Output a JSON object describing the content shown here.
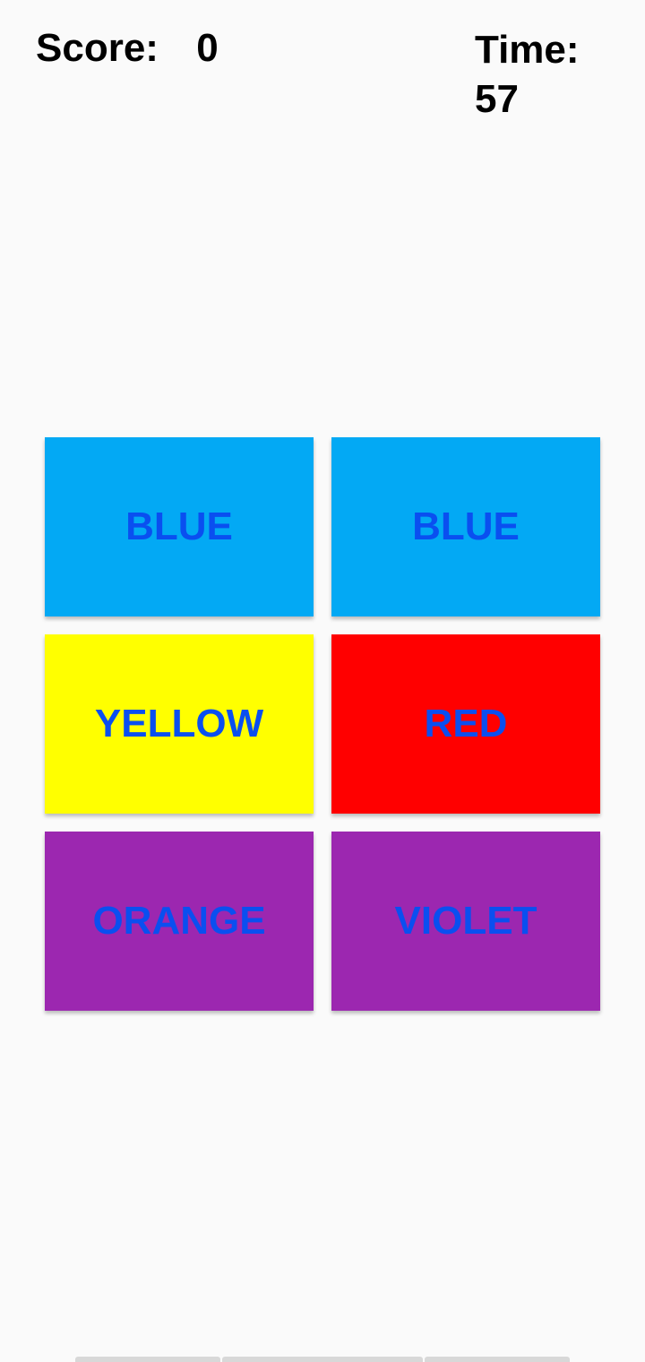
{
  "hud": {
    "score_label": "Score:",
    "score_value": "0",
    "time_label": "Time:",
    "time_value": "57"
  },
  "colors": {
    "background": "#fafafa",
    "text_color": "#0a4ff0"
  },
  "tiles": [
    {
      "word": "BLUE",
      "bg": "#03a9f4"
    },
    {
      "word": "BLUE",
      "bg": "#03a9f4"
    },
    {
      "word": "YELLOW",
      "bg": "#ffff00"
    },
    {
      "word": "RED",
      "bg": "#ff0000"
    },
    {
      "word": "ORANGE",
      "bg": "#9c27b0"
    },
    {
      "word": "VIOLET",
      "bg": "#9c27b0"
    }
  ]
}
